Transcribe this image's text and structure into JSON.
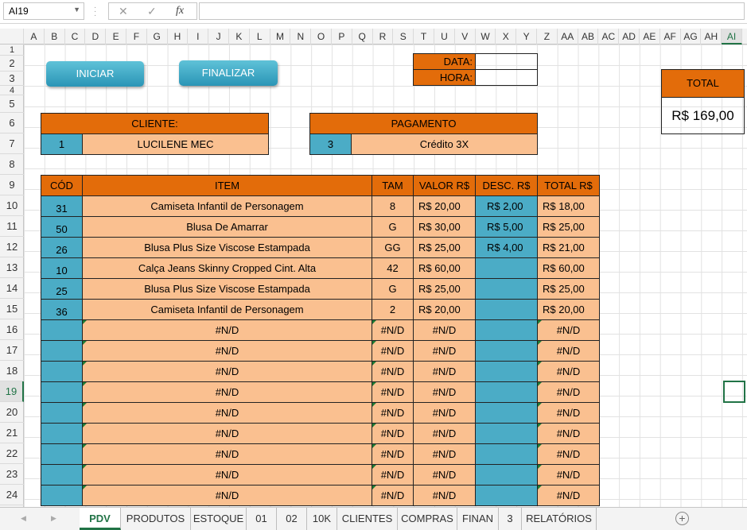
{
  "formula_bar": {
    "name_box": "AI19",
    "fx_label": "fx",
    "cancel": "✕",
    "enter": "✓",
    "formula": ""
  },
  "columns": [
    "A",
    "B",
    "C",
    "D",
    "E",
    "F",
    "G",
    "H",
    "I",
    "J",
    "K",
    "L",
    "M",
    "N",
    "O",
    "P",
    "Q",
    "R",
    "S",
    "T",
    "U",
    "V",
    "W",
    "X",
    "Y",
    "Z",
    "AA",
    "AB",
    "AC",
    "AD",
    "AE",
    "AF",
    "AG",
    "AH",
    "AI"
  ],
  "selected_column": "AI",
  "rows": [
    "1",
    "2",
    "3",
    "4",
    "5",
    "6",
    "7",
    "8",
    "9",
    "10",
    "11",
    "12",
    "13",
    "14",
    "15",
    "16",
    "17",
    "18",
    "19",
    "20",
    "21",
    "22",
    "23",
    "24"
  ],
  "selected_row": "19",
  "buttons": {
    "start": "INICIAR",
    "finish": "FINALIZAR"
  },
  "datetime": {
    "date_label": "DATA:",
    "time_label": "HORA:",
    "date_value": "",
    "time_value": ""
  },
  "total_box": {
    "label": "TOTAL",
    "value": "R$ 169,00"
  },
  "client": {
    "header": "CLIENTE:",
    "code": "1",
    "name": "LUCILENE MEC"
  },
  "payment": {
    "header": "PAGAMENTO",
    "code": "3",
    "method": "Crédito 3X"
  },
  "table": {
    "headers": {
      "code": "CÓD",
      "item": "ITEM",
      "size": "TAM",
      "value": "VALOR R$",
      "discount": "DESC. R$",
      "total": "TOTAL R$"
    },
    "rows": [
      {
        "code": "31",
        "item": "Camiseta Infantil de Personagem",
        "size": "8",
        "value": "R$  20,00",
        "discount": "R$ 2,00",
        "total": "R$  18,00"
      },
      {
        "code": "50",
        "item": "Blusa De Amarrar",
        "size": "G",
        "value": "R$  30,00",
        "discount": "R$ 5,00",
        "total": "R$  25,00"
      },
      {
        "code": "26",
        "item": "Blusa Plus Size Viscose Estampada",
        "size": "GG",
        "value": "R$  25,00",
        "discount": "R$ 4,00",
        "total": "R$  21,00"
      },
      {
        "code": "10",
        "item": "Calça Jeans Skinny Cropped Cint. Alta",
        "size": "42",
        "value": "R$  60,00",
        "discount": "",
        "total": "R$  60,00"
      },
      {
        "code": "25",
        "item": "Blusa Plus Size Viscose Estampada",
        "size": "G",
        "value": "R$  25,00",
        "discount": "",
        "total": "R$  25,00"
      },
      {
        "code": "36",
        "item": "Camiseta Infantil de Personagem",
        "size": "2",
        "value": "R$  20,00",
        "discount": "",
        "total": "R$  20,00"
      }
    ],
    "na_value": "#N/D"
  },
  "sheet_tabs": [
    "PDV",
    "PRODUTOS",
    "ESTOQUE",
    "01",
    "02",
    "10K",
    "CLIENTES",
    "COMPRAS",
    "FINAN",
    "3",
    "RELATÓRIOS"
  ],
  "active_tab": "PDV",
  "add_sheet": "+",
  "colors": {
    "orange": "#e36c0a",
    "peach": "#fac090",
    "blue": "#4bacc6",
    "excel_green": "#217346"
  }
}
